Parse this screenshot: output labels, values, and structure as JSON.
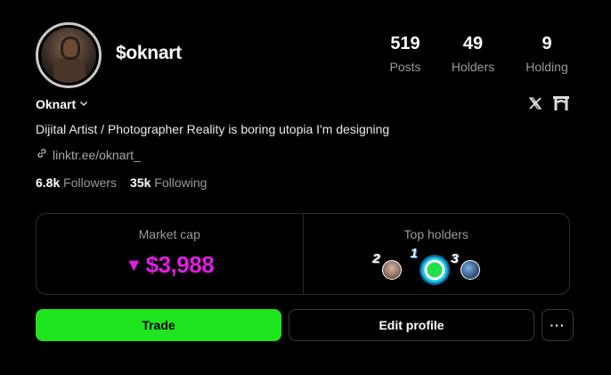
{
  "profile": {
    "handle": "$oknart",
    "name": "Oknart",
    "bio": "Dijital Artist / Photographer Reality is boring utopia I'm designing",
    "link": "linktr.ee/oknart_",
    "followers_count": "6.8k",
    "followers_label": "Followers",
    "following_count": "35k",
    "following_label": "Following"
  },
  "stats": [
    {
      "value": "519",
      "label": "Posts"
    },
    {
      "value": "49",
      "label": "Holders"
    },
    {
      "value": "9",
      "label": "Holding"
    }
  ],
  "market": {
    "label": "Market cap",
    "value": "$3,988",
    "direction_glyph": "▼",
    "color": "#e11ee1"
  },
  "top_holders": {
    "label": "Top holders",
    "ranks": [
      "2",
      "1",
      "3"
    ]
  },
  "actions": {
    "trade": "Trade",
    "edit": "Edit profile",
    "more": "···"
  },
  "icons": {
    "x": "𝕏",
    "chevron": "⌵",
    "link": "link-icon",
    "gate": "gate-icon"
  },
  "colors": {
    "accent_green": "#1fe51f",
    "market_magenta": "#e11ee1"
  }
}
